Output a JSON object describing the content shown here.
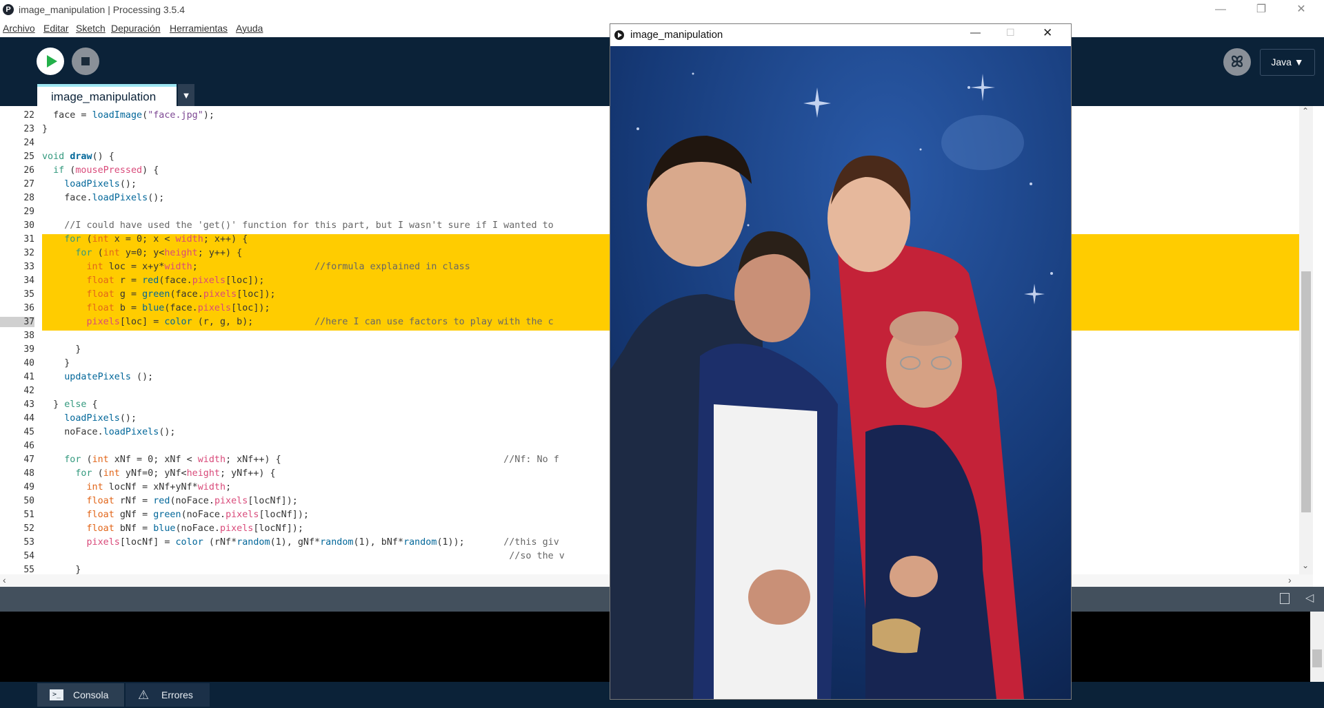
{
  "window": {
    "title": "image_manipulation | Processing 3.5.4"
  },
  "menubar": {
    "items": [
      "Archivo",
      "Editar",
      "Sketch",
      "Depuración",
      "Herramientas",
      "Ayuda"
    ]
  },
  "toolbar": {
    "mode_label": "Java ▼"
  },
  "editor": {
    "tab_label": "image_manipulation",
    "current_line": 37,
    "line_numbers": [
      "22",
      "23",
      "24",
      "25",
      "26",
      "27",
      "28",
      "29",
      "30",
      "31",
      "32",
      "33",
      "34",
      "35",
      "36",
      "37",
      "38",
      "39",
      "40",
      "41",
      "42",
      "43",
      "44",
      "45",
      "46",
      "47",
      "48",
      "49",
      "50",
      "51",
      "52",
      "53",
      "54",
      "55"
    ]
  },
  "sketch_window": {
    "title": "image_manipulation"
  },
  "console": {
    "tabs": [
      "Consola",
      "Errores"
    ]
  },
  "colors": {
    "toolbar_bg": "#0b2238",
    "highlight": "#ffcc00",
    "tab_accent": "#9de5f2",
    "run_green": "#23b04a"
  }
}
